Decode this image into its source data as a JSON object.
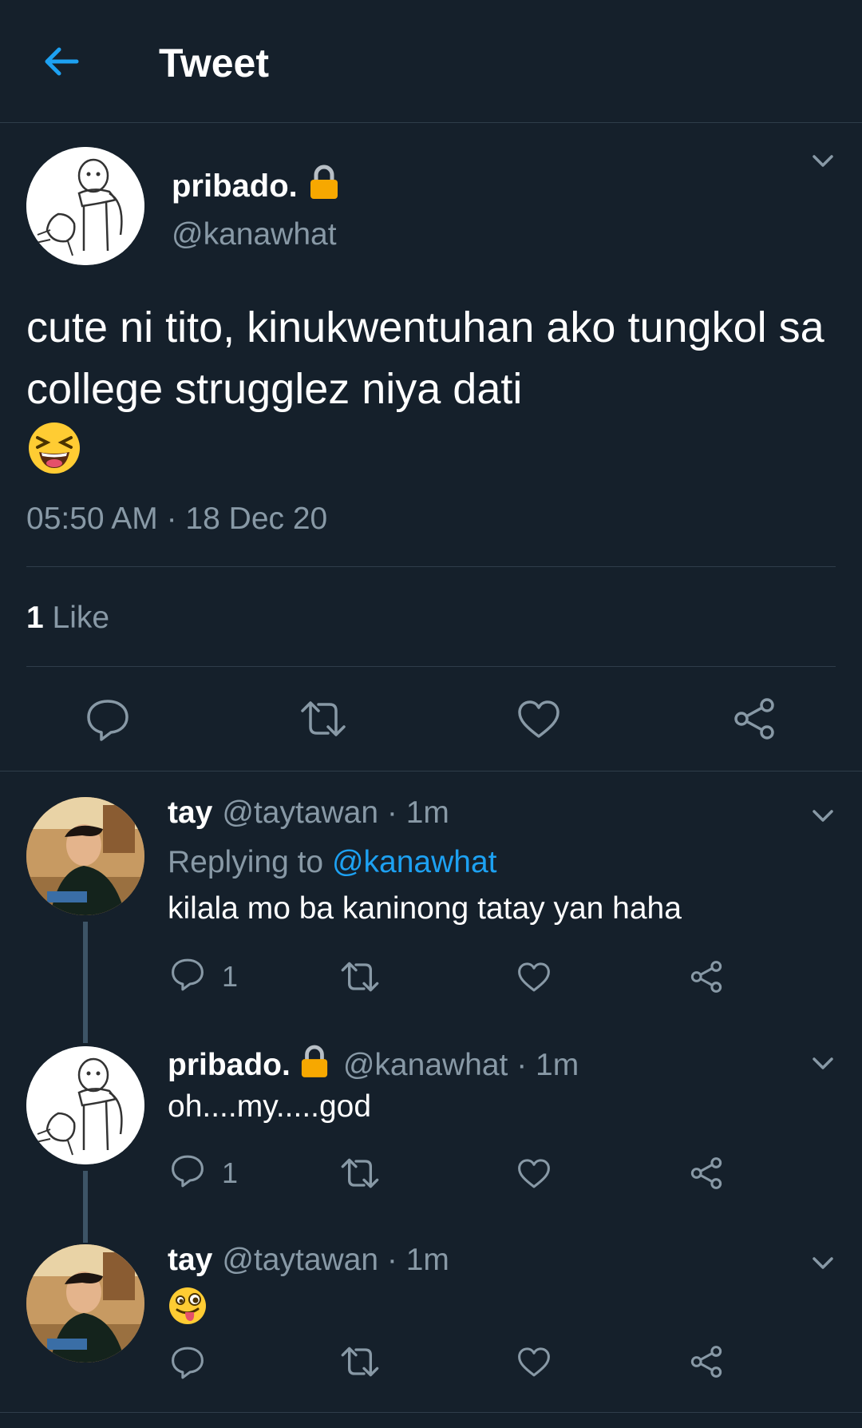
{
  "header": {
    "title": "Tweet"
  },
  "main_tweet": {
    "name": "pribado.",
    "handle": "@kanawhat",
    "text": "cute ni tito, kinukwentuhan ako tungkol sa college strugglez niya dati",
    "timestamp": "05:50 AM · 18 Dec 20",
    "likes_count": "1",
    "likes_label": "Like"
  },
  "replies": [
    {
      "name": "tay",
      "meta": "@taytawan · 1m",
      "replying_prefix": "Replying to ",
      "replying_to": "@kanawhat",
      "text": "kilala mo ba kaninong tatay yan haha",
      "reply_count": "1"
    },
    {
      "name": "pribado.",
      "meta": "@kanawhat · 1m",
      "text": "oh....my.....god",
      "reply_count": "1"
    },
    {
      "name": "tay",
      "meta": "@taytawan · 1m"
    }
  ],
  "colors": {
    "background": "#15202b",
    "accent": "#1da1f2",
    "secondary_text": "#8899a6",
    "divider": "#2f3d4a"
  },
  "icons": [
    "back-arrow-icon",
    "lock-icon",
    "chevron-down-icon",
    "reply-icon",
    "retweet-icon",
    "like-icon",
    "share-icon",
    "laughing-emoji-icon",
    "winking-tongue-emoji-icon"
  ]
}
